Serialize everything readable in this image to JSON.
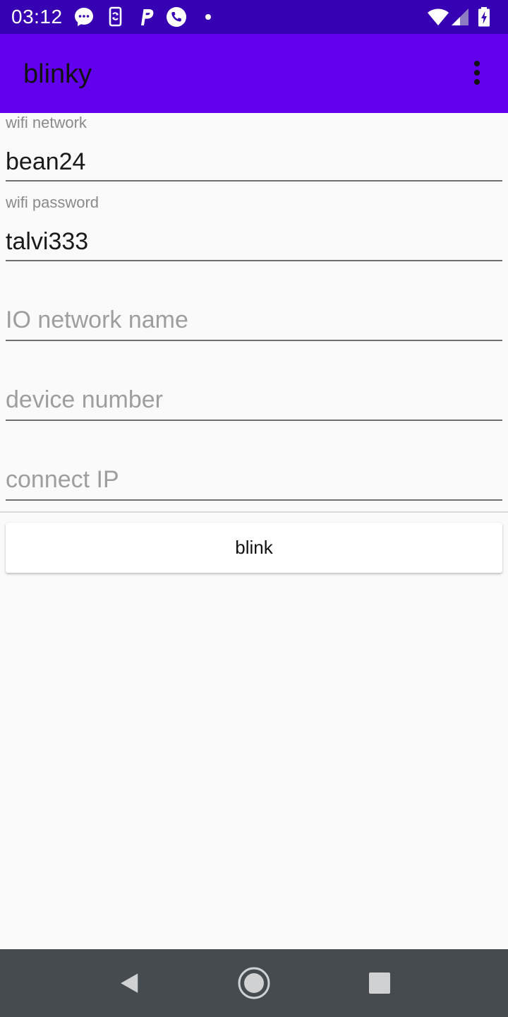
{
  "status_bar": {
    "time": "03:12",
    "icons": [
      "messenger-icon",
      "phone-sync-icon",
      "parking-p-icon",
      "phone-call-icon",
      "notification-dot-icon",
      "wifi-icon",
      "cell-signal-icon",
      "battery-charging-icon"
    ]
  },
  "app_bar": {
    "title": "blinky",
    "overflow_icon": "more-vert-icon"
  },
  "form": {
    "wifi_network": {
      "label": "wifi network",
      "value": "bean24",
      "placeholder": ""
    },
    "wifi_password": {
      "label": "wifi password",
      "value": "talvi333",
      "placeholder": ""
    },
    "io_network_name": {
      "value": "",
      "placeholder": "IO network name"
    },
    "device_number": {
      "value": "",
      "placeholder": "device number"
    },
    "connect_ip": {
      "value": "",
      "placeholder": "connect IP"
    }
  },
  "actions": {
    "blink_label": "blink"
  },
  "nav_bar": {
    "icons": [
      "back-icon",
      "home-icon",
      "recents-icon"
    ]
  },
  "colors": {
    "status_bar": "#3700b3",
    "app_bar": "#6200ee",
    "nav_bar": "#464b50",
    "background": "#fafafa"
  }
}
